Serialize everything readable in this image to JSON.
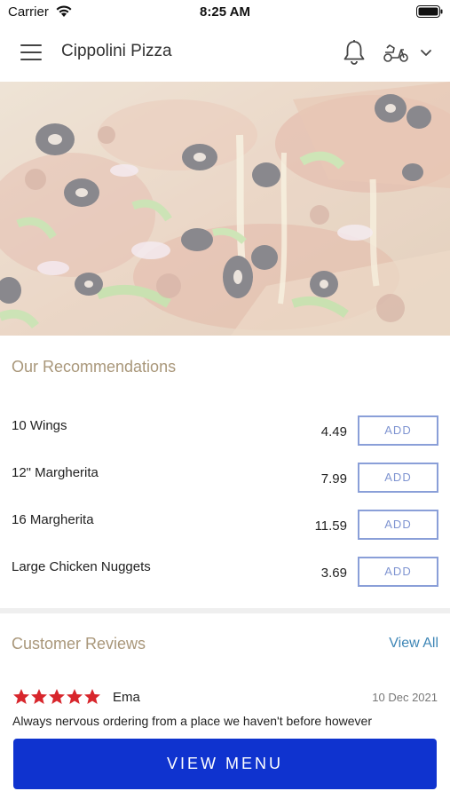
{
  "status_bar": {
    "carrier": "Carrier",
    "time": "8:25 AM",
    "icons": [
      "wifi-icon",
      "battery-icon"
    ]
  },
  "header": {
    "title": "Cippolini Pizza",
    "icons": [
      "menu-icon",
      "bell-icon",
      "scooter-icon",
      "chevron-down-icon"
    ]
  },
  "recommendations": {
    "title": "Our Recommendations",
    "items": [
      {
        "name": "10 Wings",
        "price": "4.49",
        "add_label": "ADD"
      },
      {
        "name": "12\" Margherita",
        "price": "7.99",
        "add_label": "ADD"
      },
      {
        "name": "16 Margherita",
        "price": "11.59",
        "add_label": "ADD"
      },
      {
        "name": "Large Chicken Nuggets",
        "price": "3.69",
        "add_label": "ADD"
      }
    ]
  },
  "reviews": {
    "title": "Customer Reviews",
    "view_all": "View All",
    "items": [
      {
        "rating": 5,
        "name": "Ema",
        "date": "10 Dec 2021",
        "text": "Always nervous ordering from a place we haven't before however"
      }
    ]
  },
  "cta": {
    "label": "VIEW MENU"
  },
  "colors": {
    "accent_title": "#a9977a",
    "add_button_border": "#8a9fd8",
    "link": "#3e86b6",
    "cta_background": "#0f33cf",
    "star": "#d8262c"
  }
}
